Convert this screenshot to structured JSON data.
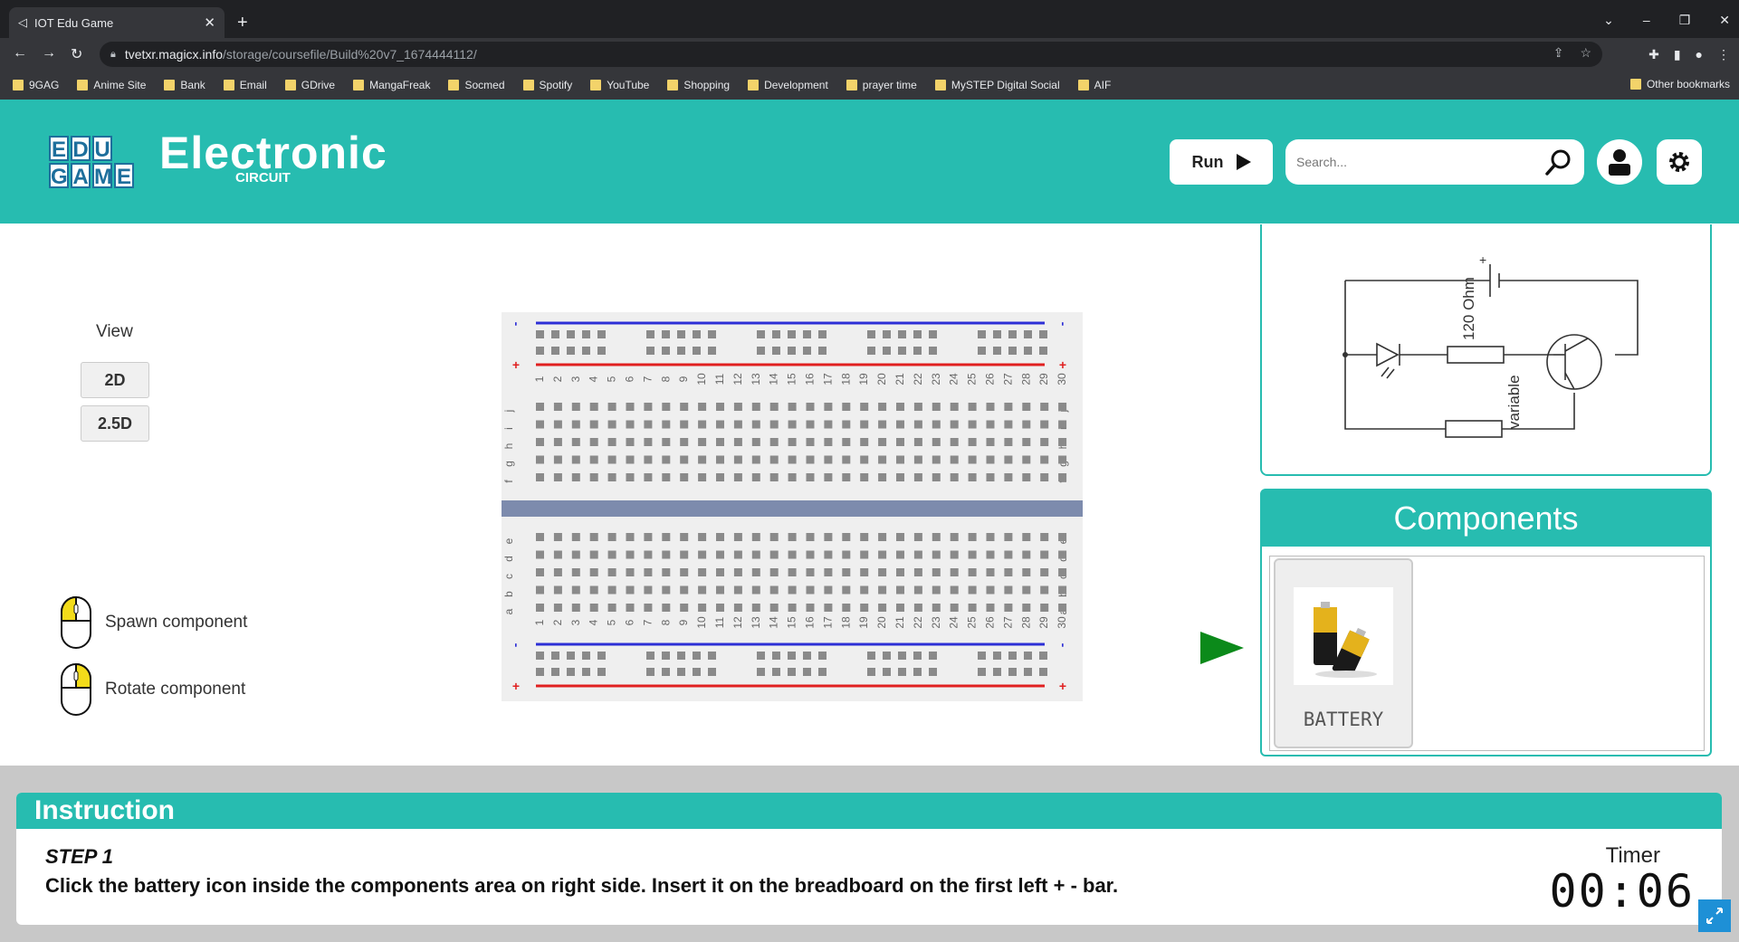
{
  "browser": {
    "tab_title": "IOT Edu Game",
    "url_host": "tvetxr.magicx.info",
    "url_path": "/storage/coursefile/Build%20v7_1674444112/",
    "bookmarks": [
      "9GAG",
      "Anime Site",
      "Bank",
      "Email",
      "GDrive",
      "MangaFreak",
      "Socmed",
      "Spotify",
      "YouTube",
      "Shopping",
      "Development",
      "prayer time",
      "MySTEP Digital Social",
      "AIF"
    ],
    "other_bookmarks": "Other bookmarks"
  },
  "header": {
    "logo_letters": [
      "E",
      "D",
      "U",
      "",
      "G",
      "A",
      "M",
      "E"
    ],
    "title": "Electronic",
    "subtitle": "CIRCUIT",
    "run_label": "Run",
    "search_placeholder": "Search..."
  },
  "view": {
    "label": "View",
    "options": [
      "2D",
      "2.5D"
    ]
  },
  "hints": {
    "spawn": "Spawn component",
    "rotate": "Rotate component"
  },
  "breadboard": {
    "columns": [
      "1",
      "2",
      "3",
      "4",
      "5",
      "6",
      "7",
      "8",
      "9",
      "10",
      "11",
      "12",
      "13",
      "14",
      "15",
      "16",
      "17",
      "18",
      "19",
      "20",
      "21",
      "22",
      "23",
      "24",
      "25",
      "26",
      "27",
      "28",
      "29",
      "30"
    ],
    "rows_top": [
      "j",
      "i",
      "h",
      "g",
      "f"
    ],
    "rows_bottom": [
      "e",
      "d",
      "c",
      "b",
      "a"
    ],
    "rail_plus": "+",
    "rail_minus": "-"
  },
  "schematic": {
    "resistor1_label": "120 Ohm",
    "resistor2_label": "variable",
    "battery_plus": "+"
  },
  "components": {
    "title": "Components",
    "items": [
      {
        "label": "BATTERY"
      }
    ]
  },
  "instruction": {
    "heading": "Instruction",
    "step": "STEP 1",
    "text": "Click the battery icon inside the components area on right side. Insert it on the breadboard on the first left + - bar.",
    "timer_label": "Timer",
    "timer_value": "00:06"
  },
  "colors": {
    "accent": "#27bcb0",
    "rail_blue": "#2d2fd6",
    "rail_red": "#e02020",
    "arrow": "#0b8a1a"
  }
}
